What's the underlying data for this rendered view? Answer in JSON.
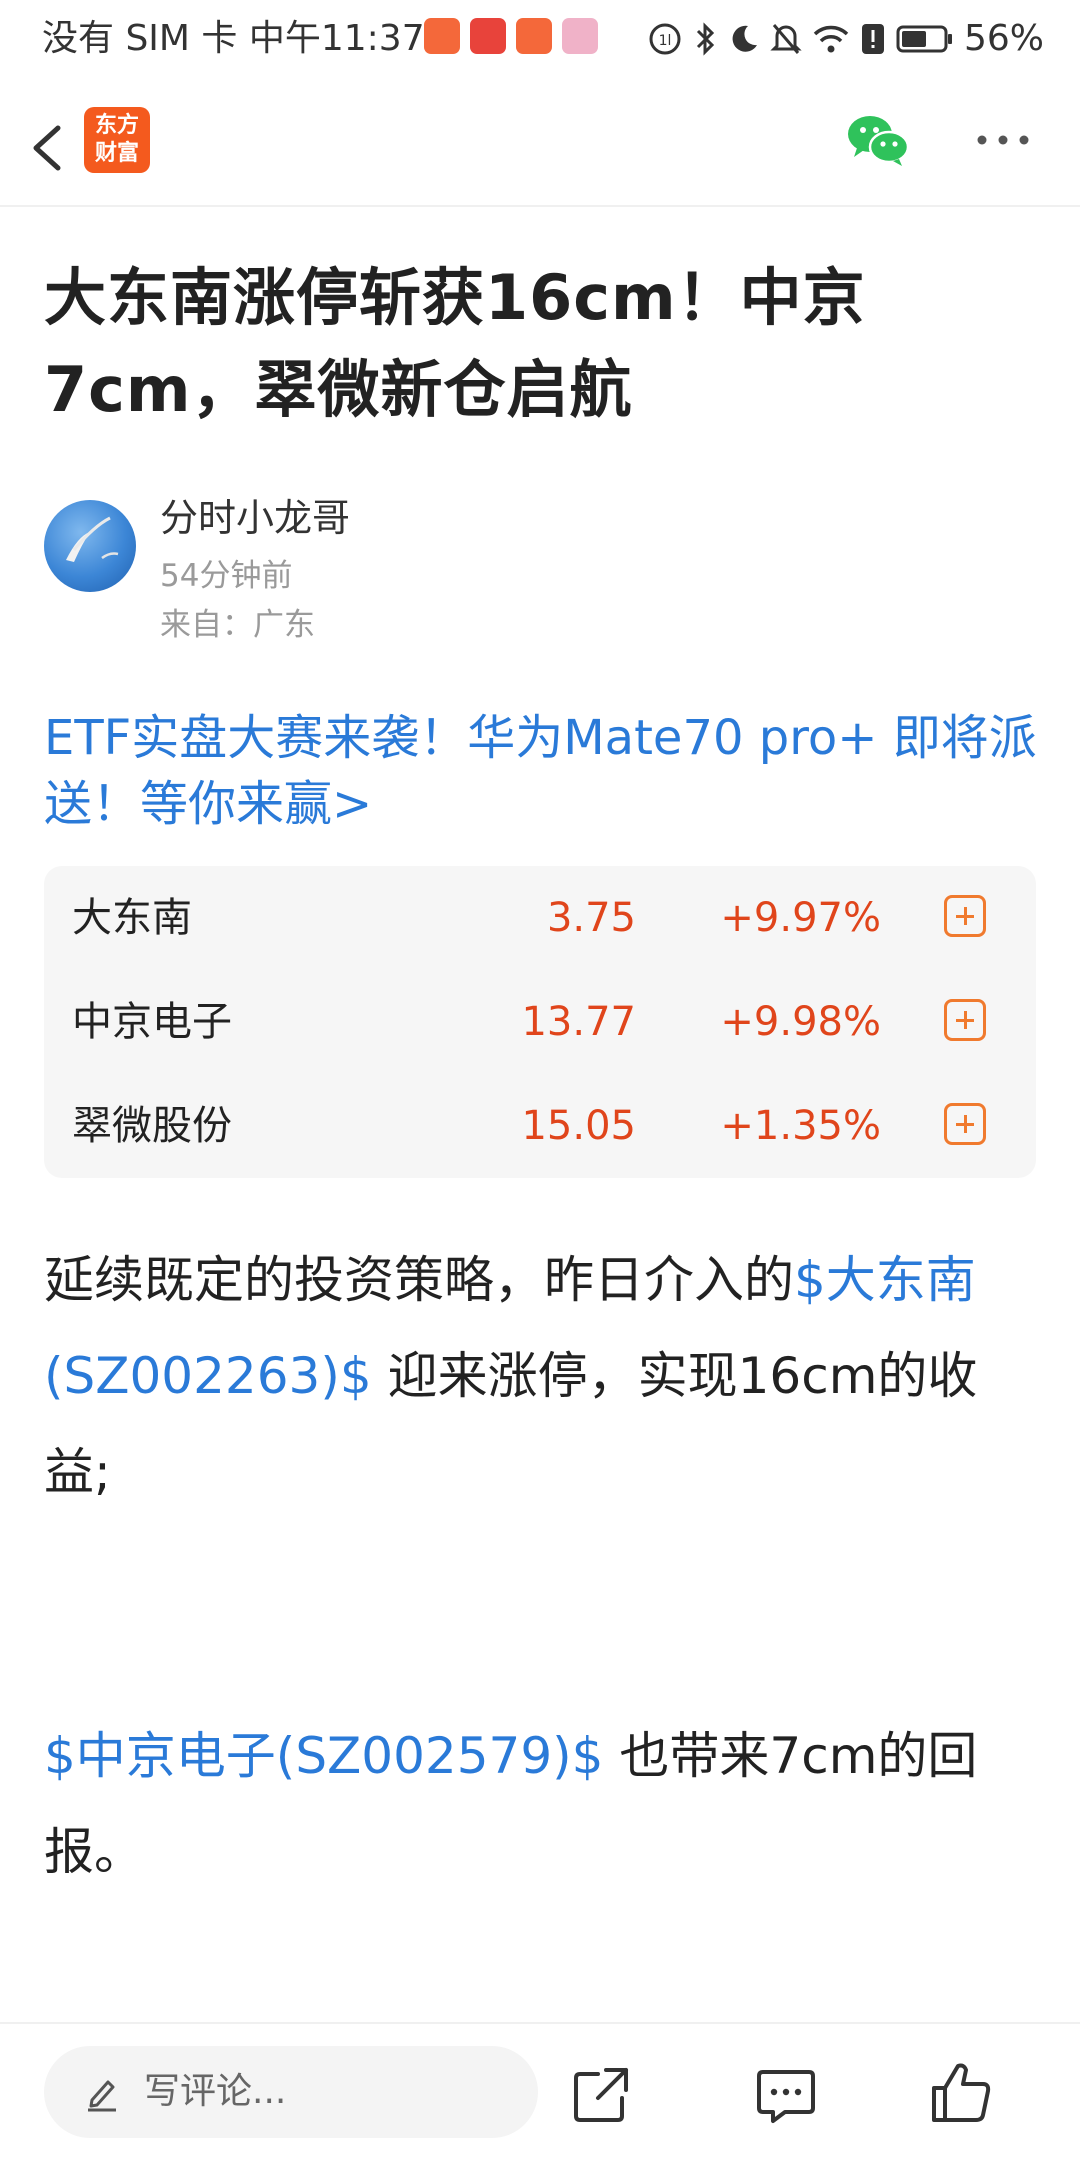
{
  "status_bar": {
    "left_text": "没有 SIM 卡 中午11:37",
    "battery": "56%"
  },
  "nav": {
    "brand_line1": "东方",
    "brand_line2": "财富"
  },
  "article": {
    "title": "大东南涨停斩获16cm！中京7cm，翠微新仓启航",
    "author": "分时小龙哥",
    "time": "54分钟前",
    "location": "来自：广东",
    "promo": "ETF实盘大赛来袭！华为Mate70 pro+ 即将派送！等你来赢>"
  },
  "stocks": [
    {
      "name": "大东南",
      "price": "3.75",
      "change": "+9.97%"
    },
    {
      "name": "中京电子",
      "price": "13.77",
      "change": "+9.98%"
    },
    {
      "name": "翠微股份",
      "price": "15.05",
      "change": "+1.35%"
    }
  ],
  "body": {
    "p1_text_a": "延续既定的投资策略，昨日介入的",
    "p1_link": "$大东南(SZ002263)$",
    "p1_text_b": " 迎来涨停，实现16cm的收益;",
    "p2_link": "$中京电子(SZ002579)$",
    "p2_text": " 也带来7cm的回报。"
  },
  "bottom_bar": {
    "comment_placeholder": "写评论..."
  },
  "colors": {
    "up_red": "#e0451b",
    "link_blue": "#2a7ad8",
    "brand_orange": "#f45a1e",
    "add_orange": "#f07a2e"
  }
}
